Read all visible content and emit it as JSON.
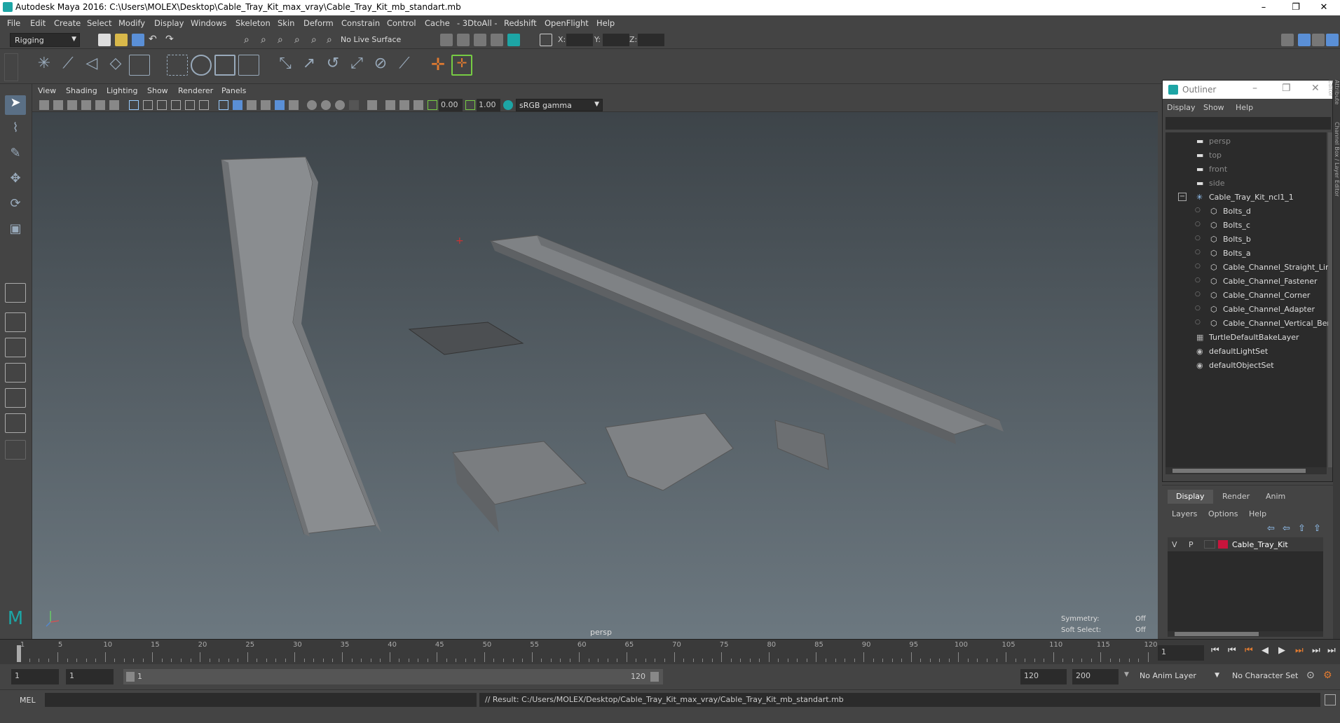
{
  "window": {
    "title": "Autodesk Maya 2016: C:\\Users\\MOLEX\\Desktop\\Cable_Tray_Kit_max_vray\\Cable_Tray_Kit_mb_standart.mb",
    "minimize": "–",
    "restore": "❐",
    "close": "✕"
  },
  "menubar": [
    "File",
    "Edit",
    "Create",
    "Select",
    "Modify",
    "Display",
    "Windows",
    "Skeleton",
    "Skin",
    "Deform",
    "Constrain",
    "Control",
    "Cache",
    "- 3DtoAll -",
    "Redshift",
    "OpenFlight",
    "Help"
  ],
  "status": {
    "mode": "Rigging",
    "live_surface": "No Live Surface",
    "x_label": "X:",
    "y_label": "Y:",
    "z_label": "Z:"
  },
  "viewport_menu": [
    "View",
    "Shading",
    "Lighting",
    "Show",
    "Renderer",
    "Panels"
  ],
  "viewport_toolbar": {
    "value1": "0.00",
    "value2": "1.00",
    "color_space": "sRGB gamma"
  },
  "viewport": {
    "camera_label": "persp",
    "symmetry_label": "Symmetry:",
    "symmetry_value": "Off",
    "soft_select_label": "Soft Select:",
    "soft_select_value": "Off"
  },
  "outliner": {
    "title": "Outliner",
    "menu": [
      "Display",
      "Show",
      "Help"
    ],
    "items": [
      {
        "label": "persp",
        "type": "camera",
        "indent": 0
      },
      {
        "label": "top",
        "type": "camera",
        "indent": 0
      },
      {
        "label": "front",
        "type": "camera",
        "indent": 0
      },
      {
        "label": "side",
        "type": "camera",
        "indent": 0
      },
      {
        "label": "Cable_Tray_Kit_ncl1_1",
        "type": "group",
        "indent": 0
      },
      {
        "label": "Bolts_d",
        "type": "mesh",
        "indent": 1
      },
      {
        "label": "Bolts_c",
        "type": "mesh",
        "indent": 1
      },
      {
        "label": "Bolts_b",
        "type": "mesh",
        "indent": 1
      },
      {
        "label": "Bolts_a",
        "type": "mesh",
        "indent": 1
      },
      {
        "label": "Cable_Channel_Straight_Lin",
        "type": "mesh",
        "indent": 1
      },
      {
        "label": "Cable_Channel_Fastener",
        "type": "mesh",
        "indent": 1
      },
      {
        "label": "Cable_Channel_Corner",
        "type": "mesh",
        "indent": 1
      },
      {
        "label": "Cable_Channel_Adapter",
        "type": "mesh",
        "indent": 1
      },
      {
        "label": "Cable_Channel_Vertical_Ben",
        "type": "mesh",
        "indent": 1
      },
      {
        "label": "TurtleDefaultBakeLayer",
        "type": "layer",
        "indent": 0
      },
      {
        "label": "defaultLightSet",
        "type": "set",
        "indent": 0
      },
      {
        "label": "defaultObjectSet",
        "type": "set",
        "indent": 0
      }
    ]
  },
  "side_tabs": [
    "Channel Box / Layer Editor",
    "Attribute Editor"
  ],
  "layer_editor": {
    "tabs": [
      "Display",
      "Render",
      "Anim"
    ],
    "menu": [
      "Layers",
      "Options",
      "Help"
    ],
    "layer": {
      "v": "V",
      "p": "P",
      "name": "Cable_Tray_Kit",
      "color": "#c8143c"
    }
  },
  "timeline": {
    "ticks": [
      1,
      5,
      10,
      15,
      20,
      25,
      30,
      35,
      40,
      45,
      50,
      55,
      60,
      65,
      70,
      75,
      80,
      85,
      90,
      95,
      100,
      105,
      110,
      115,
      120
    ],
    "current_frame": "1"
  },
  "range": {
    "start": "1",
    "start_inner": "1",
    "slider_start": "1",
    "slider_end": "120",
    "end_inner": "120",
    "end": "200",
    "anim_layer": "No Anim Layer",
    "character_set": "No Character Set"
  },
  "command": {
    "lang": "MEL",
    "result": "// Result: C:/Users/MOLEX/Desktop/Cable_Tray_Kit_max_vray/Cable_Tray_Kit_mb_standart.mb"
  },
  "colors": {
    "accent": "#1da5a5",
    "viewport_top": "#3d4449",
    "viewport_bottom": "#6c7880",
    "layer_color": "#c8143c"
  }
}
